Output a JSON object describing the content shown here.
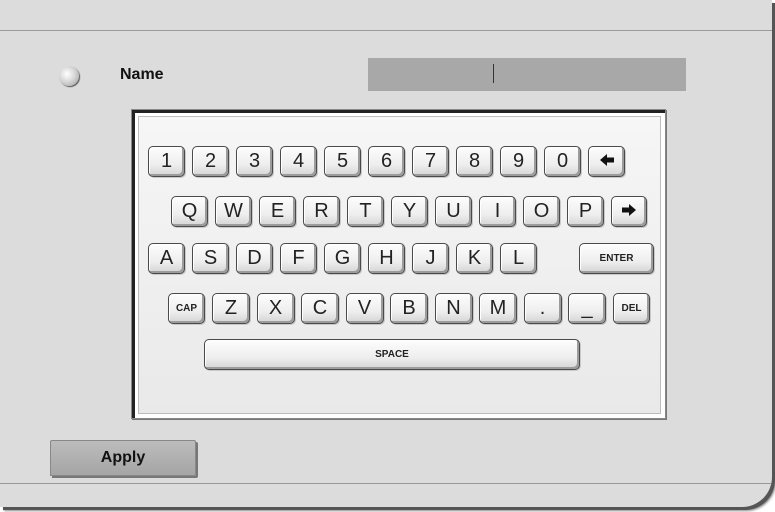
{
  "form": {
    "name_label": "Name",
    "name_value": ""
  },
  "keyboard": {
    "row1": [
      "1",
      "2",
      "3",
      "4",
      "5",
      "6",
      "7",
      "8",
      "9",
      "0"
    ],
    "row1_backspace_icon": "left-arrow-icon",
    "row2": [
      "Q",
      "W",
      "E",
      "R",
      "T",
      "Y",
      "U",
      "I",
      "O",
      "P"
    ],
    "row2_forward_icon": "right-arrow-icon",
    "row3": [
      "A",
      "S",
      "D",
      "F",
      "G",
      "H",
      "J",
      "K",
      "L"
    ],
    "enter_label": "ENTER",
    "cap_label": "CAP",
    "row4": [
      "Z",
      "X",
      "C",
      "V",
      "B",
      "N",
      "M",
      ".",
      "_"
    ],
    "del_label": "DEL",
    "space_label": "SPACE"
  },
  "actions": {
    "apply_label": "Apply"
  }
}
